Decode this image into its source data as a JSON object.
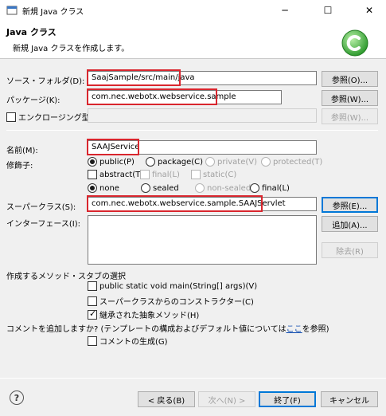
{
  "window": {
    "title": "新規 Java クラス",
    "minimize": "─",
    "maximize": "☐",
    "close": "✕"
  },
  "header": {
    "title": "Java クラス",
    "description": "新規 Java クラスを作成します。"
  },
  "source_folder": {
    "label": "ソース・フォルダ(D):",
    "value": "SaajSample/src/main/java",
    "button": "参照(O)..."
  },
  "package": {
    "label": "パッケージ(K):",
    "value": "com.nec.webotx.webservice.sample",
    "button": "参照(W)..."
  },
  "enclosing": {
    "label": "エンクロージング型(Y):",
    "value": "",
    "button": "参照(W)..."
  },
  "name": {
    "label": "名前(M):",
    "value": "SAAJService"
  },
  "modifiers": {
    "label": "修飾子:",
    "visibility": [
      "public(P)",
      "package(C)",
      "private(V)",
      "protected(T)"
    ],
    "flags": [
      "abstract(T)",
      "final(L)",
      "static(C)"
    ],
    "inheritance": [
      "none",
      "sealed",
      "non-sealed",
      "final(L)"
    ]
  },
  "superclass": {
    "label": "スーパークラス(S):",
    "value": "com.nec.webotx.webservice.sample.SAAJServlet",
    "button": "参照(E)..."
  },
  "interfaces": {
    "label": "インターフェース(I):",
    "add_button": "追加(A)...",
    "remove_button": "除去(R)"
  },
  "stubs": {
    "label": "作成するメソッド・スタブの選択",
    "main": "public static void main(String[] args)(V)",
    "constructors": "スーパークラスからのコンストラクター(C)",
    "inherited": "継承された抽象メソッド(H)"
  },
  "comments": {
    "question_before": "コメントを追加しますか? (テンプレートの構成およびデフォルト値については",
    "link": "ここ",
    "question_after": "を参照)",
    "generate": "コメントの生成(G)"
  },
  "footer": {
    "help": "?",
    "back": "< 戻る(B)",
    "next": "次へ(N) >",
    "finish": "終了(F)",
    "cancel": "キャンセル"
  },
  "colors": {
    "highlight": "#d9262e",
    "logo": "#3aa63a"
  }
}
